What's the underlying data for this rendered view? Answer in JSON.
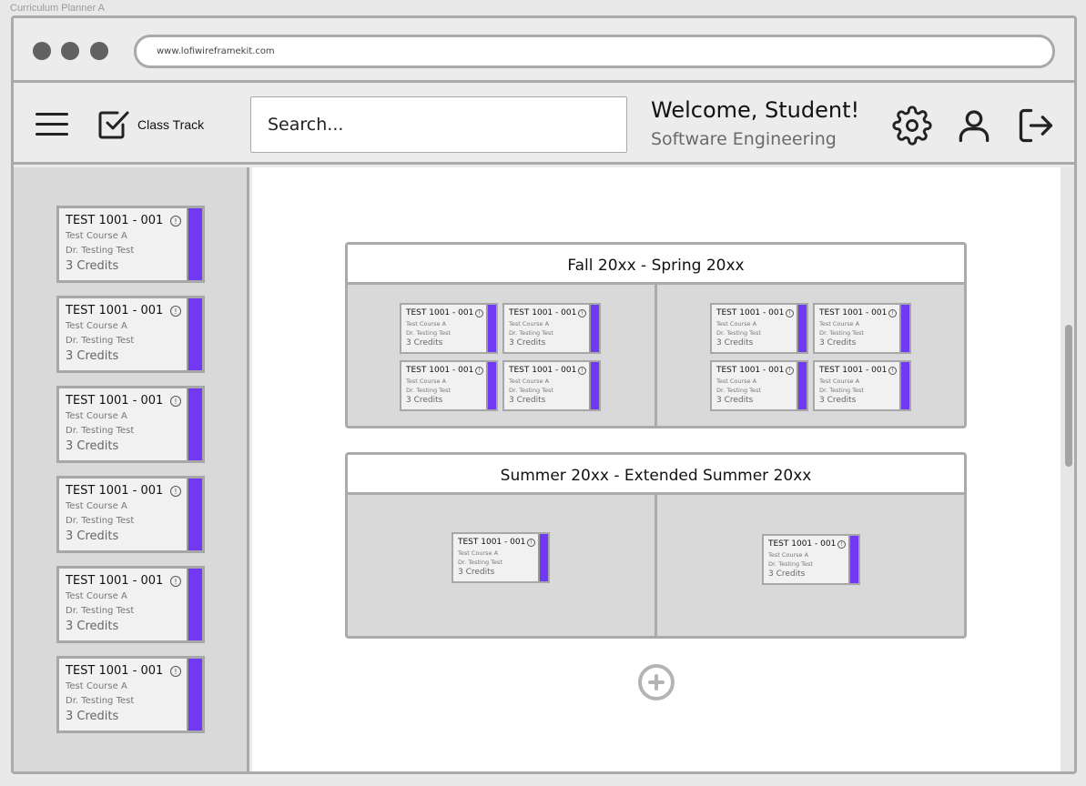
{
  "frame_title": "Curriculum Planner A",
  "browser": {
    "url": "www.lofiwireframekit.com"
  },
  "header": {
    "app_name": "Class Track",
    "search_placeholder": "Search...",
    "welcome": "Welcome, Student!",
    "major": "Software Engineering"
  },
  "course": {
    "code": "TEST 1001 - 001",
    "info": "!",
    "name": "Test Course A",
    "instructor": "Dr. Testing Test",
    "credits": "3 Credits"
  },
  "terms": [
    {
      "title": "Fall 20xx - Spring 20xx"
    },
    {
      "title": "Summer 20xx - Extended Summer 20xx"
    }
  ],
  "colors": {
    "accent": "#7239f5",
    "border": "#aaaaaa",
    "panel": "#d9d9d9"
  },
  "icons": [
    "menu-icon",
    "checkbox-logo-icon",
    "gear-icon",
    "user-icon",
    "logout-icon",
    "plus-icon"
  ]
}
